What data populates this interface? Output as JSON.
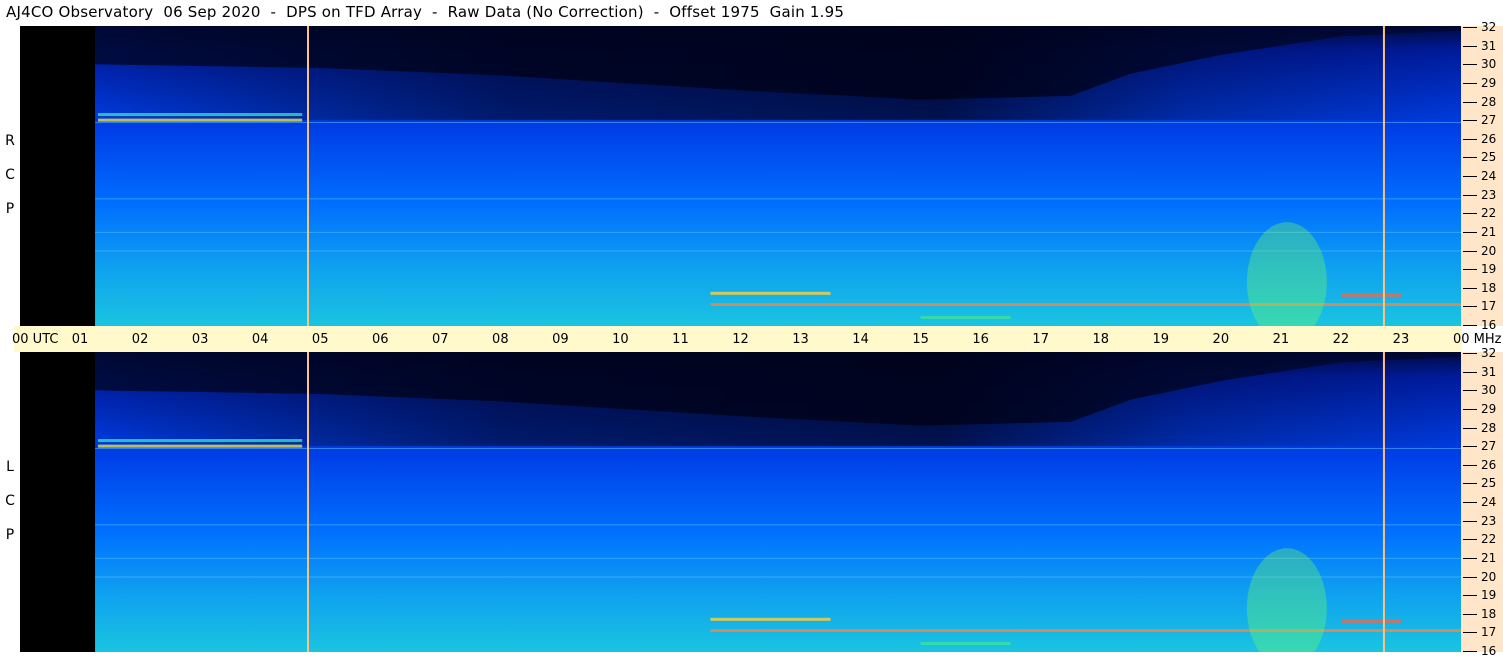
{
  "title": "AJ4CO Observatory  06 Sep 2020  -  DPS on TFD Array  -  Raw Data (No Correction)  -  Offset 1975  Gain 1.95",
  "chart_data": {
    "type": "heatmap",
    "title": "AJ4CO Observatory  06 Sep 2020  -  DPS on TFD Array  -  Raw Data (No Correction)  -  Offset 1975  Gain 1.95",
    "x_axis": {
      "ticks": [
        "00 UTC",
        "01",
        "02",
        "03",
        "04",
        "05",
        "06",
        "07",
        "08",
        "09",
        "10",
        "11",
        "12",
        "13",
        "14",
        "15",
        "16",
        "17",
        "18",
        "19",
        "20",
        "21",
        "22",
        "23",
        "00 MHz"
      ],
      "range_hours": [
        0,
        24
      ]
    },
    "y_axis": {
      "unit": "MHz",
      "range": [
        16,
        32
      ],
      "ticks": [
        "32",
        "31",
        "30",
        "29",
        "28",
        "27",
        "26",
        "25",
        "24",
        "23",
        "22",
        "21",
        "20",
        "19",
        "18",
        "17",
        "16"
      ]
    },
    "panels": [
      {
        "label_letters": [
          "R",
          "C",
          "P"
        ]
      },
      {
        "label_letters": [
          "L",
          "C",
          "P"
        ]
      }
    ],
    "data_start_hour": 1.25,
    "vertical_markers_hours": [
      4.78,
      22.7
    ],
    "colors": {
      "no_data": "#000000",
      "low": "#000a4a",
      "mid": "#0050ff",
      "high": "#10c0e0",
      "peak": "#ffe040",
      "marker": "#ffc080",
      "timebar": "#fff9cc",
      "freq_axis_bg": "#ffe6c8"
    }
  }
}
